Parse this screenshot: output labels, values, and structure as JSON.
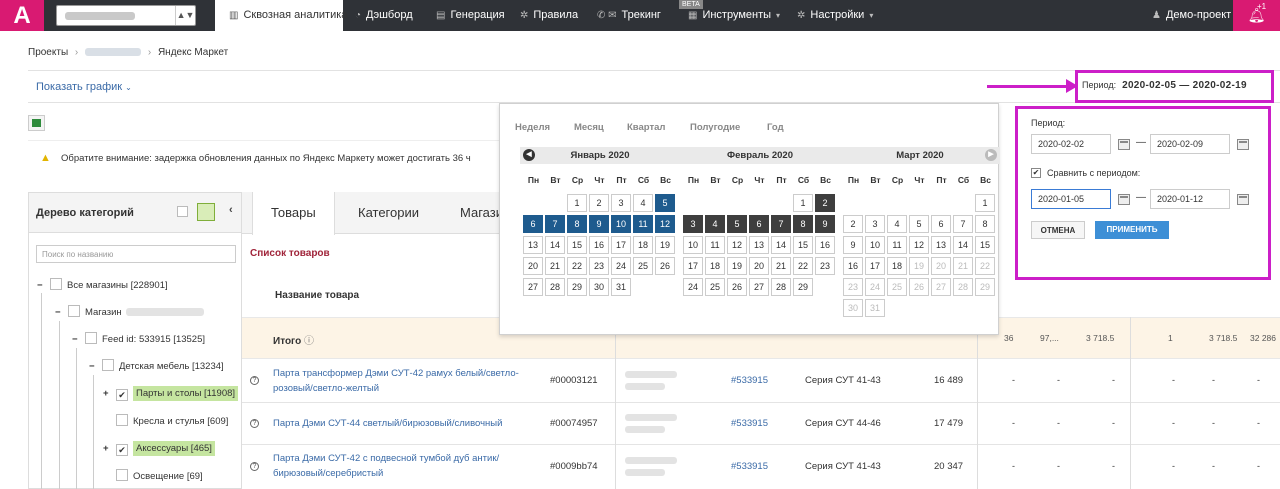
{
  "app": {
    "logo": "A",
    "project_select_arrow": "▲▼"
  },
  "nav": {
    "items": [
      {
        "label": "Сквозная аналитика",
        "icon": "bar-chart-icon"
      },
      {
        "label": "Дэшборд",
        "icon": "dashboard-icon"
      },
      {
        "label": "Генерация",
        "icon": "file-icon"
      },
      {
        "label": "Правила",
        "icon": "gear-icon"
      },
      {
        "label": "Трекинг",
        "icon": "phone-mail-icon"
      },
      {
        "label": "Инструменты",
        "icon": "grid-icon"
      },
      {
        "label": "Настройки",
        "icon": "gear-icon"
      }
    ],
    "beta": "BETA",
    "demo_project": "Демо-проект",
    "bell_count": "+1"
  },
  "breadcrumb": {
    "projects": "Проекты",
    "current": "Яндекс Маркет"
  },
  "show_chart": "Показать график",
  "period_top": {
    "label": "Период:",
    "value": "2020-02-05 — 2020-02-19"
  },
  "notice": "Обратите внимание: задержка обновления данных по Яндекс Маркету может достигать 36 ч",
  "tree": {
    "title": "Дерево категорий",
    "search_placeholder": "Поиск по названию",
    "items": [
      {
        "label": "Все магазины [228901]"
      },
      {
        "label": "Магазин"
      },
      {
        "label": "Feed id: 533915 [13525]"
      },
      {
        "label": "Детская мебель [13234]"
      },
      {
        "label": "Парты и столы [11908]"
      },
      {
        "label": "Кресла и стулья [609]"
      },
      {
        "label": "Аксессуары [465]"
      },
      {
        "label": "Освещение [69]"
      }
    ]
  },
  "tabs": [
    "Товары",
    "Категории",
    "Магази"
  ],
  "products_header": "Список товаров",
  "name_column": "Название товара",
  "total": {
    "label": "Итого",
    "values": [
      "36",
      "97,...",
      "3 718.5",
      "1",
      "3 718.5",
      "32 286"
    ]
  },
  "rows": [
    {
      "name": "Парта трансформер Дэми СУТ-42 рамух белый/светло-розовый/светло-желтый",
      "sku": "#00003121",
      "feed": "#533915",
      "series": "Серия СУТ 41-43",
      "value": "16 489"
    },
    {
      "name": "Парта Дэми СУТ-44 светлый/бирюзовый/сливочный",
      "sku": "#00074957",
      "feed": "#533915",
      "series": "Серия СУТ 44-46",
      "value": "17 479"
    },
    {
      "name": "Парта Дэми СУТ-42 с подвесной тумбой дуб антик/бирюзовый/серебристый",
      "sku": "#0009bb74",
      "feed": "#533915",
      "series": "Серия СУТ 41-43",
      "value": "20 347"
    }
  ],
  "dash": "-",
  "calendar": {
    "ranges": [
      "Неделя",
      "Месяц",
      "Квартал",
      "Полугодие",
      "Год"
    ],
    "weekdays": [
      "Пн",
      "Вт",
      "Ср",
      "Чт",
      "Пт",
      "Сб",
      "Вс"
    ],
    "months": [
      {
        "name": "Январь 2020",
        "start": 2,
        "days": 31,
        "blue": [
          5,
          6,
          7,
          8,
          9,
          10,
          11,
          12
        ],
        "dark": []
      },
      {
        "name": "Февраль 2020",
        "start": 5,
        "days": 29,
        "blue": [],
        "dark": [
          2,
          3,
          4,
          5,
          6,
          7,
          8,
          9
        ]
      },
      {
        "name": "Март 2020",
        "start": 6,
        "days": 31,
        "blue": [],
        "dark": [],
        "disabled_from": 19
      }
    ]
  },
  "period_panel": {
    "period_label": "Период:",
    "from": "2020-02-02",
    "to": "2020-02-09",
    "compare_label": "Сравнить с периодом:",
    "compare_from": "2020-01-05",
    "compare_to": "2020-01-12",
    "cancel": "ОТМЕНА",
    "apply": "ПРИМЕНИТЬ",
    "separator": "—"
  },
  "colors": {
    "accent": "#d91a72",
    "annotation": "#cc1fc8",
    "blue": "#1e5b8e",
    "link": "#3a6aa7"
  }
}
